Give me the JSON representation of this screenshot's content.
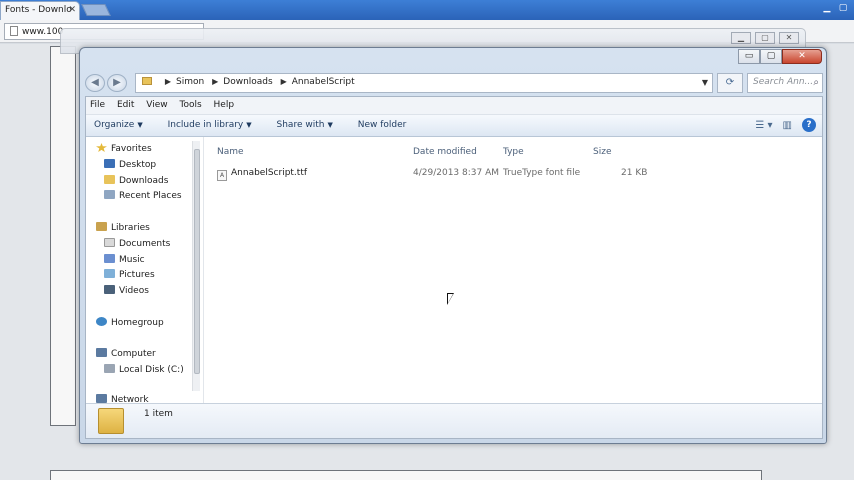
{
  "browser": {
    "tab_title": "Fonts - Downlo",
    "tab_close": "✕",
    "address": "www.100"
  },
  "window": {
    "minimize": "▭",
    "maximize": "▢",
    "close": "✕"
  },
  "nav": {
    "back": "◀",
    "forward": "▶",
    "breadcrumb": [
      "Simon",
      "Downloads",
      "AnnabelScript"
    ],
    "search_placeholder": "Search Ann..."
  },
  "menu": [
    "File",
    "Edit",
    "View",
    "Tools",
    "Help"
  ],
  "commands": {
    "organize": "Organize",
    "include": "Include in library",
    "share": "Share with",
    "new_folder": "New folder"
  },
  "sidebar": {
    "favorites": "Favorites",
    "desktop": "Desktop",
    "downloads": "Downloads",
    "recent": "Recent Places",
    "libraries": "Libraries",
    "documents": "Documents",
    "music": "Music",
    "pictures": "Pictures",
    "videos": "Videos",
    "homegroup": "Homegroup",
    "computer": "Computer",
    "local_disk": "Local Disk (C:)",
    "network": "Network"
  },
  "columns": {
    "name": "Name",
    "date": "Date modified",
    "type": "Type",
    "size": "Size"
  },
  "file": {
    "name": "AnnabelScript.ttf",
    "date": "4/29/2013 8:37 AM",
    "type": "TrueType font file",
    "size": "21 KB"
  },
  "status": {
    "item_count": "1 item"
  },
  "colors": {
    "accent": "#2b63b8",
    "folder": "#e8c35a"
  }
}
